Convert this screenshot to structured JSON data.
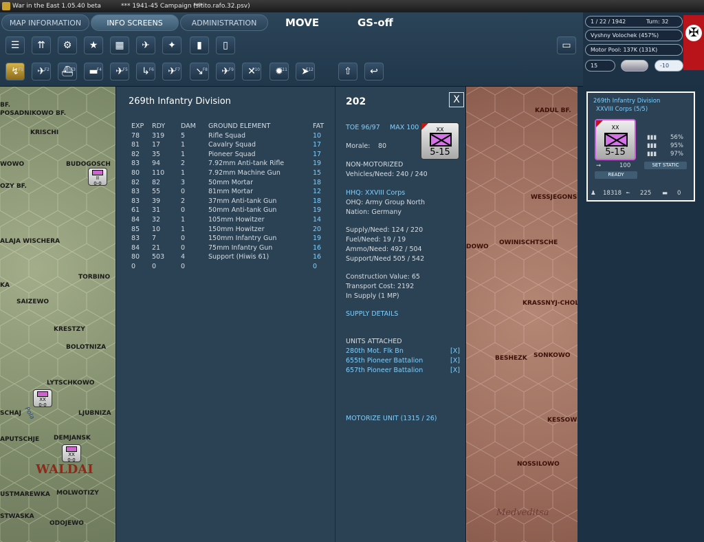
{
  "window": {
    "title": "War in the East 1.05.40 beta",
    "campaign": "***   1941-45 Campaign   ***",
    "file": "(sitito.rafo.32.psv)"
  },
  "tabs": [
    {
      "label": "MAP INFORMATION",
      "active": false
    },
    {
      "label": "INFO SCREENS",
      "active": true
    },
    {
      "label": "ADMINISTRATION",
      "active": false
    }
  ],
  "mode_tabs": {
    "move": "MOVE",
    "gs": "GS-off"
  },
  "toolbar1": [
    "layers-icon",
    "units-icon",
    "gear-icon",
    "star-icon",
    "weather-icon",
    "air-icon",
    "bomb-icon",
    "fuel-icon",
    "card-icon"
  ],
  "toolbar2": [
    {
      "icon": "path-icon",
      "key": "F1"
    },
    {
      "icon": "fighter-icon",
      "key": "F2"
    },
    {
      "icon": "ship-icon",
      "key": "F3"
    },
    {
      "icon": "transport-icon",
      "key": "F4"
    },
    {
      "icon": "intercept-icon",
      "key": "F5"
    },
    {
      "icon": "recon-icon",
      "key": "F6"
    },
    {
      "icon": "airfield-icon",
      "key": "F7"
    },
    {
      "icon": "ground-attack-icon",
      "key": "F8"
    },
    {
      "icon": "paradrop-icon",
      "key": "F9"
    },
    {
      "icon": "strike-icon",
      "key": "F10"
    },
    {
      "icon": "explosion-icon",
      "key": "F11"
    },
    {
      "icon": "compass-icon",
      "key": "F12"
    }
  ],
  "info": {
    "date": "1 / 22 / 1942",
    "turn": "Turn: 32",
    "location": "Vyshny Volochek  (457%)",
    "motor_pool": "Motor Pool: 137K (131K)",
    "counter": "15",
    "weather_value": "-10"
  },
  "panel": {
    "title": "269th Infantry Division",
    "toe_count": "202",
    "close": "X",
    "headers": [
      "EXP",
      "RDY",
      "DAM",
      "GROUND ELEMENT",
      "FAT"
    ],
    "rows": [
      [
        "78",
        "319",
        "5",
        "Rifle Squad",
        "10"
      ],
      [
        "81",
        "17",
        "1",
        "Cavalry Squad",
        "17"
      ],
      [
        "82",
        "35",
        "1",
        "Pioneer Squad",
        "17"
      ],
      [
        "83",
        "94",
        "2",
        "7.92mm Anti-tank Rifle",
        "19"
      ],
      [
        "80",
        "110",
        "1",
        "7.92mm Machine Gun",
        "15"
      ],
      [
        "82",
        "82",
        "3",
        "50mm Mortar",
        "18"
      ],
      [
        "83",
        "55",
        "0",
        "81mm Mortar",
        "12"
      ],
      [
        "83",
        "39",
        "2",
        "37mm Anti-tank Gun",
        "18"
      ],
      [
        "61",
        "31",
        "0",
        "50mm Anti-tank Gun",
        "19"
      ],
      [
        "84",
        "32",
        "1",
        "105mm Howitzer",
        "14"
      ],
      [
        "85",
        "10",
        "1",
        "150mm Howitzer",
        "20"
      ],
      [
        "83",
        "7",
        "0",
        "150mm Infantry Gun",
        "19"
      ],
      [
        "84",
        "21",
        "0",
        "75mm Infantry Gun",
        "16"
      ],
      [
        "80",
        "503",
        "4",
        "Support (Hiwis 61)",
        "16"
      ],
      [
        "0",
        "0",
        "0",
        "",
        "0"
      ]
    ],
    "toe": "TOE 96/97",
    "max": "MAX 100",
    "morale_label": "Morale:",
    "morale": "80",
    "motorization": "NON-MOTORIZED",
    "vehicles": "Vehicles/Need:   240 / 240",
    "hhq": "HHQ: XXVIII Corps",
    "ohq": "OHQ: Army Group North",
    "nation": "Nation:   Germany",
    "supply": "Supply/Need:   124 / 220",
    "fuel": "Fuel/Need:      19 / 19",
    "ammo": "Ammo/Need:    492 / 504",
    "support": "Support/Need    505 / 542",
    "construction": "Construction Value:  65",
    "transport": "Transport Cost:     2192",
    "in_supply": "In Supply (1 MP)",
    "supply_details": "SUPPLY DETAILS",
    "units_attached_label": "UNITS ATTACHED",
    "attached": [
      {
        "name": "280th Mot. Flk Bn",
        "x": "[X]"
      },
      {
        "name": "655th Pioneer Battalion",
        "x": "[X]"
      },
      {
        "name": "657th Pioneer Battalion",
        "x": "[X]"
      }
    ],
    "motorize": "MOTORIZE UNIT (1315 / 26)",
    "counter": {
      "size": "XX",
      "strength": "5-15"
    }
  },
  "unit_card": {
    "name": "269th Infantry Division",
    "corps": "XXVIII Corps (5/5)",
    "counter": {
      "size": "XX",
      "strength": "5-15"
    },
    "pct1": "56%",
    "pct2": "95%",
    "pct3": "97%",
    "move": "100",
    "ready": "READY",
    "set_static": "SET STATIC",
    "men": "18318",
    "guns": "225",
    "tanks": "0"
  },
  "map": {
    "left_towns": [
      "BF.",
      "POSADNIKOWO BF.",
      "KRISCHI",
      "WOWO",
      "BUDOGOSCH",
      "OZY BF.",
      "ALAJA WISCHERA",
      "TORBINO",
      "KA",
      "SAIZEWO",
      "KRESTZY",
      "BOLOTNIZA",
      "LYTSCHKOWO",
      "SCHAJ",
      "LJUBNIZA",
      "APUTSCHJE",
      "DEMJANSK",
      "MOLWOTIZY",
      "USTMAREWKA",
      "STWASKA",
      "ODOJEWO"
    ],
    "waldai": "WALDAI",
    "right_towns": [
      "KADUL BF.",
      "WESSJEGONSK",
      "DOWO",
      "OWINISCHTSCHE",
      "KRASSNYJ-CHOLM",
      "BESHEZK",
      "SONKOWO",
      "KESSOW",
      "NOSSILOWO"
    ],
    "medv": "Medveditsa",
    "polist": "Pola"
  }
}
